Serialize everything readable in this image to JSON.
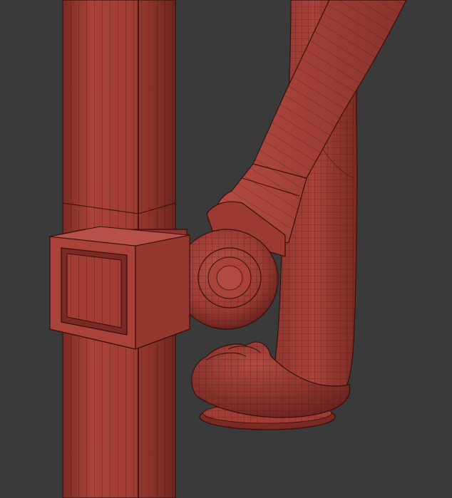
{
  "scene": {
    "background_color": "#3a3a3a",
    "model_color": "#a8423a",
    "model_shadow_color": "#5c1c18",
    "model_highlight_color": "#c45a4f",
    "wireframe_color": "#3a0e0b",
    "parts": [
      "vertical-post",
      "post-collar-bracket",
      "rear-curved-leg",
      "diagonal-arm",
      "pivot-knob",
      "scroll-foot",
      "foot-base-disc"
    ]
  }
}
